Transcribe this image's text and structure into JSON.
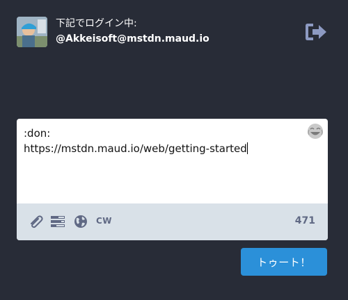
{
  "account": {
    "login_label": "下記でログイン中:",
    "handle": "@Akkeisoft@mstdn.maud.io",
    "avatar_icon": "user-avatar-photo"
  },
  "header": {
    "logout_icon": "sign-out-icon"
  },
  "compose": {
    "text": ":don:\nhttps://mstdn.maud.io/web/getting-started",
    "emoji_icon": "emoji-picker-icon",
    "toolbar": {
      "attach_icon": "paperclip-icon",
      "poll_icon": "poll-icon",
      "visibility_icon": "globe-icon",
      "cw_label": "CW",
      "char_count": "471"
    }
  },
  "toot_button": {
    "label": "トゥート！"
  },
  "colors": {
    "background": "#282c37",
    "accent": "#2b90d9",
    "toolbar": "#d9e1e8",
    "icon": "#606984"
  }
}
